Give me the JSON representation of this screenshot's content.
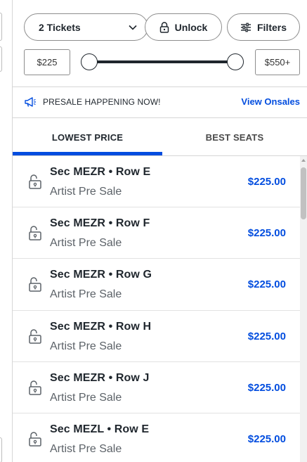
{
  "filters": {
    "tickets_label": "2 Tickets",
    "unlock_label": "Unlock",
    "filters_label": "Filters"
  },
  "price": {
    "min_label": "$225",
    "max_label": "$550+"
  },
  "presale": {
    "text": "PRESALE HAPPENING NOW!",
    "link": "View Onsales"
  },
  "tabs": [
    {
      "label": "LOWEST PRICE",
      "active": true
    },
    {
      "label": "BEST SEATS",
      "active": false
    }
  ],
  "listings": [
    {
      "title": "Sec MEZR • Row E",
      "subtitle": "Artist Pre Sale",
      "price": "$225.00"
    },
    {
      "title": "Sec MEZR • Row F",
      "subtitle": "Artist Pre Sale",
      "price": "$225.00"
    },
    {
      "title": "Sec MEZR • Row G",
      "subtitle": "Artist Pre Sale",
      "price": "$225.00"
    },
    {
      "title": "Sec MEZR • Row H",
      "subtitle": "Artist Pre Sale",
      "price": "$225.00"
    },
    {
      "title": "Sec MEZR • Row J",
      "subtitle": "Artist Pre Sale",
      "price": "$225.00"
    },
    {
      "title": "Sec MEZL • Row E",
      "subtitle": "Artist Pre Sale",
      "price": "$225.00"
    }
  ],
  "colors": {
    "accent": "#024ddf",
    "text": "#1f262d",
    "muted": "#5c6268"
  },
  "icons": {
    "tickets_dropdown": "chevron-down-icon",
    "unlock": "lock-icon",
    "filters": "sliders-icon",
    "presale": "megaphone-icon",
    "listing": "unlocked-padlock-icon"
  }
}
